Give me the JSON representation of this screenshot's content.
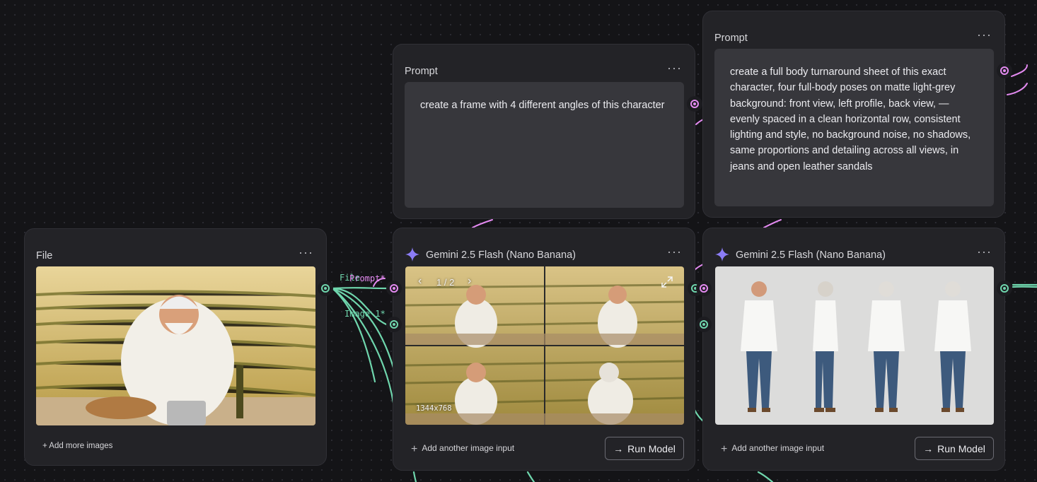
{
  "file_node": {
    "title": "File",
    "menu": "···",
    "add_more": "+ Add more images"
  },
  "prompt_node_1": {
    "title": "Prompt",
    "menu": "···",
    "text": "create a frame with 4 different angles of this character"
  },
  "prompt_node_2": {
    "title": "Prompt",
    "menu": "···",
    "text": "create a full body turnaround sheet of this exact character, four full-body poses on matte light-grey background: front view, left profile, back view, — evenly spaced in a clean horizontal row, consistent lighting and style, no background noise, no shadows, same proportions and detailing across all views,  in jeans and open leather sandals"
  },
  "gemini_node_1": {
    "title": "Gemini 2.5 Flash (Nano Banana)",
    "menu": "···",
    "pager": "1 / 2",
    "resolution": "1344x768",
    "add_input": "Add another image input",
    "run": "Run Model"
  },
  "gemini_node_2": {
    "title": "Gemini 2.5 Flash (Nano Banana)",
    "menu": "···",
    "add_input": "Add another image input",
    "run": "Run Model"
  },
  "edge_labels": {
    "file": "File",
    "prompt": "Prompt*",
    "image": "Image 1*"
  },
  "colors": {
    "canvas": "#141417",
    "node": "#232327",
    "image_edge": "#6fd6ad",
    "text_edge": "#e38af0",
    "gemini_accent": "#8b7cf6"
  },
  "icons": {
    "menu": "more-horizontal-icon",
    "gemini": "sparkle-icon",
    "prev": "chevron-left-icon",
    "next": "chevron-right-icon",
    "expand": "expand-icon",
    "add": "plus-icon",
    "run": "arrow-right-icon"
  }
}
